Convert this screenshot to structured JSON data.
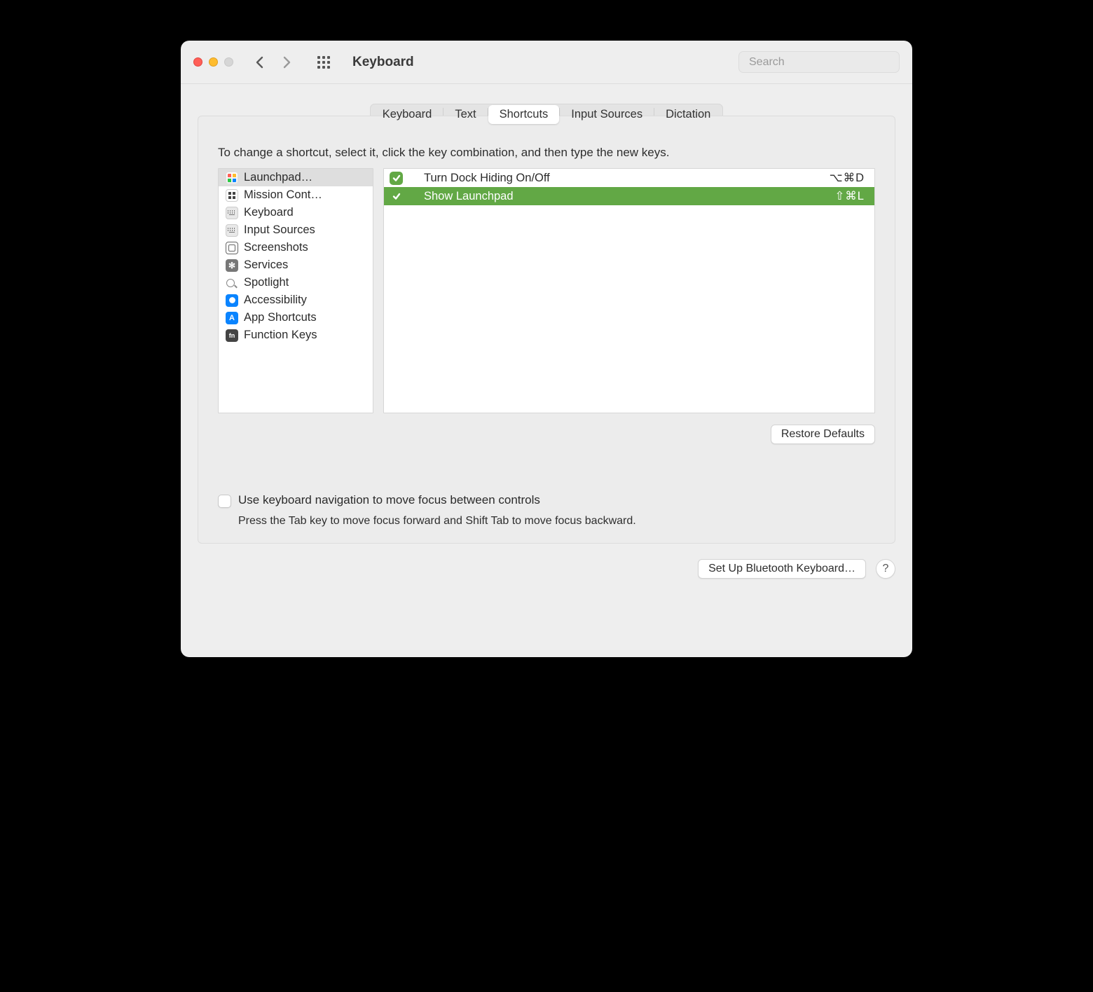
{
  "window": {
    "title": "Keyboard",
    "search_placeholder": "Search"
  },
  "tabs": [
    {
      "label": "Keyboard"
    },
    {
      "label": "Text"
    },
    {
      "label": "Shortcuts"
    },
    {
      "label": "Input Sources"
    },
    {
      "label": "Dictation"
    }
  ],
  "active_tab": "Shortcuts",
  "instructions": "To change a shortcut, select it, click the key combination, and then type the new keys.",
  "sidebar": {
    "items": [
      {
        "label": "Launchpad…",
        "icon": "launchpad",
        "selected": true
      },
      {
        "label": "Mission Cont…",
        "icon": "mission"
      },
      {
        "label": "Keyboard",
        "icon": "keyboard"
      },
      {
        "label": "Input Sources",
        "icon": "input"
      },
      {
        "label": "Screenshots",
        "icon": "screenshots"
      },
      {
        "label": "Services",
        "icon": "services"
      },
      {
        "label": "Spotlight",
        "icon": "spotlight"
      },
      {
        "label": "Accessibility",
        "icon": "accessibility"
      },
      {
        "label": "App Shortcuts",
        "icon": "appshort"
      },
      {
        "label": "Function Keys",
        "icon": "fn"
      }
    ]
  },
  "shortcuts": {
    "rows": [
      {
        "label": "Turn Dock Hiding On/Off",
        "keys": "⌥⌘D",
        "checked": true,
        "selected": false
      },
      {
        "label": "Show Launchpad",
        "keys": "⇧⌘L",
        "checked": true,
        "selected": true
      }
    ]
  },
  "buttons": {
    "restore": "Restore Defaults",
    "bluetooth": "Set Up Bluetooth Keyboard…",
    "help": "?"
  },
  "kbnav": {
    "label": "Use keyboard navigation to move focus between controls",
    "sub": "Press the Tab key to move focus forward and Shift Tab to move focus backward.",
    "checked": false
  }
}
